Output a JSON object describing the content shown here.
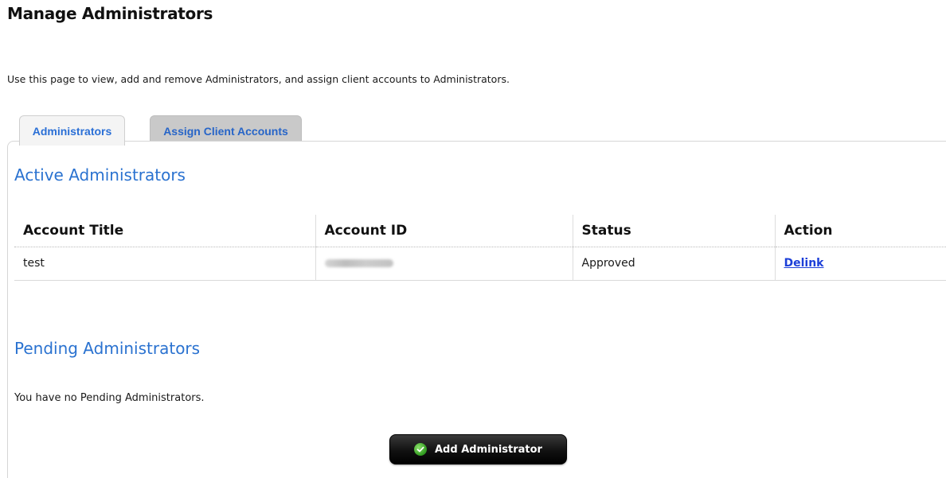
{
  "header": {
    "title": "Manage Administrators",
    "intro": "Use this page to view, add and remove Administrators, and assign client accounts to Administrators."
  },
  "tabs": [
    {
      "label": "Administrators",
      "active": true
    },
    {
      "label": "Assign Client Accounts",
      "active": false
    }
  ],
  "active_section": {
    "heading": "Active Administrators",
    "columns": [
      "Account Title",
      "Account ID",
      "Status",
      "Action"
    ],
    "rows": [
      {
        "account_title": "test",
        "account_id": "",
        "status": "Approved",
        "action": "Delink"
      }
    ]
  },
  "pending_section": {
    "heading": "Pending Administrators",
    "empty_message": "You have no Pending Administrators."
  },
  "add_button": {
    "label": "Add Administrator",
    "icon": "check-icon"
  },
  "colors": {
    "accent": "#2a72d0",
    "link": "#1c3fd8",
    "button_bg": "#111111",
    "check_green": "#2f9a1f"
  }
}
